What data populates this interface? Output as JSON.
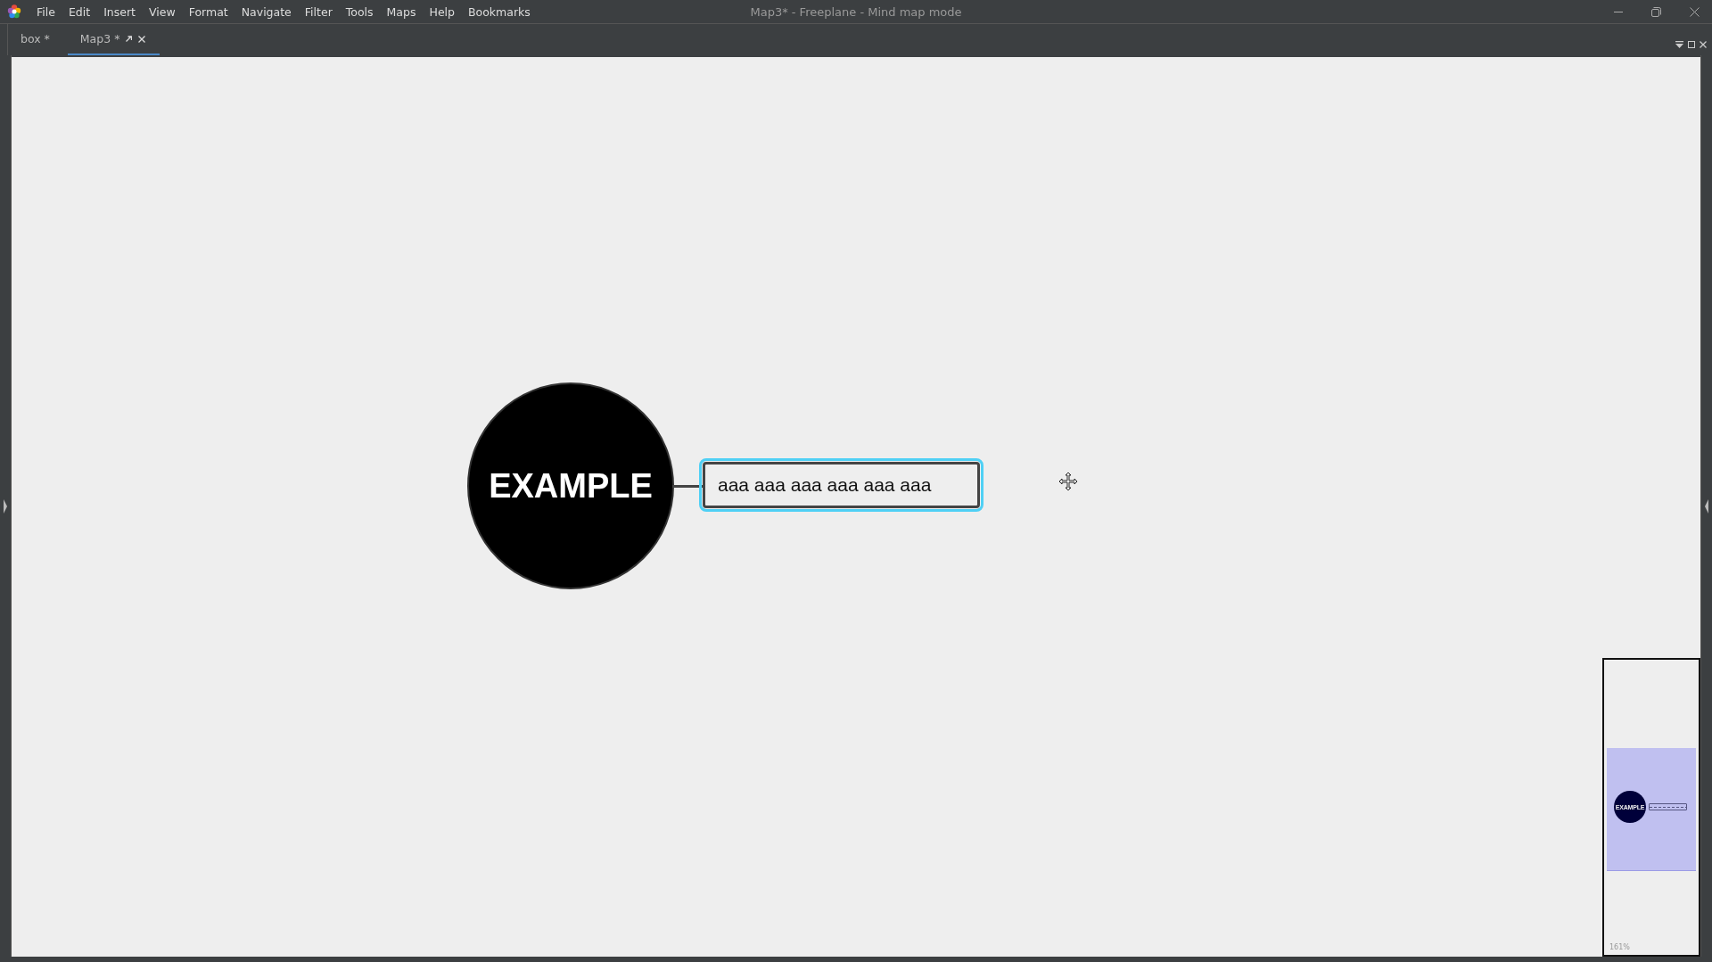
{
  "window": {
    "title": "Map3* - Freeplane - Mind map mode"
  },
  "menu": [
    "File",
    "Edit",
    "Insert",
    "View",
    "Format",
    "Navigate",
    "Filter",
    "Tools",
    "Maps",
    "Help",
    "Bookmarks"
  ],
  "tabs": [
    {
      "label": "box *",
      "selected": false
    },
    {
      "label": "Map3 *",
      "selected": true
    }
  ],
  "map": {
    "root": {
      "text": "EXAMPLE"
    },
    "children": [
      {
        "text": "aaa aaa aaa aaa aaa aaa",
        "selected": true
      }
    ]
  },
  "minimap": {
    "root_text": "EXAMPLE",
    "zoom": "161%"
  }
}
